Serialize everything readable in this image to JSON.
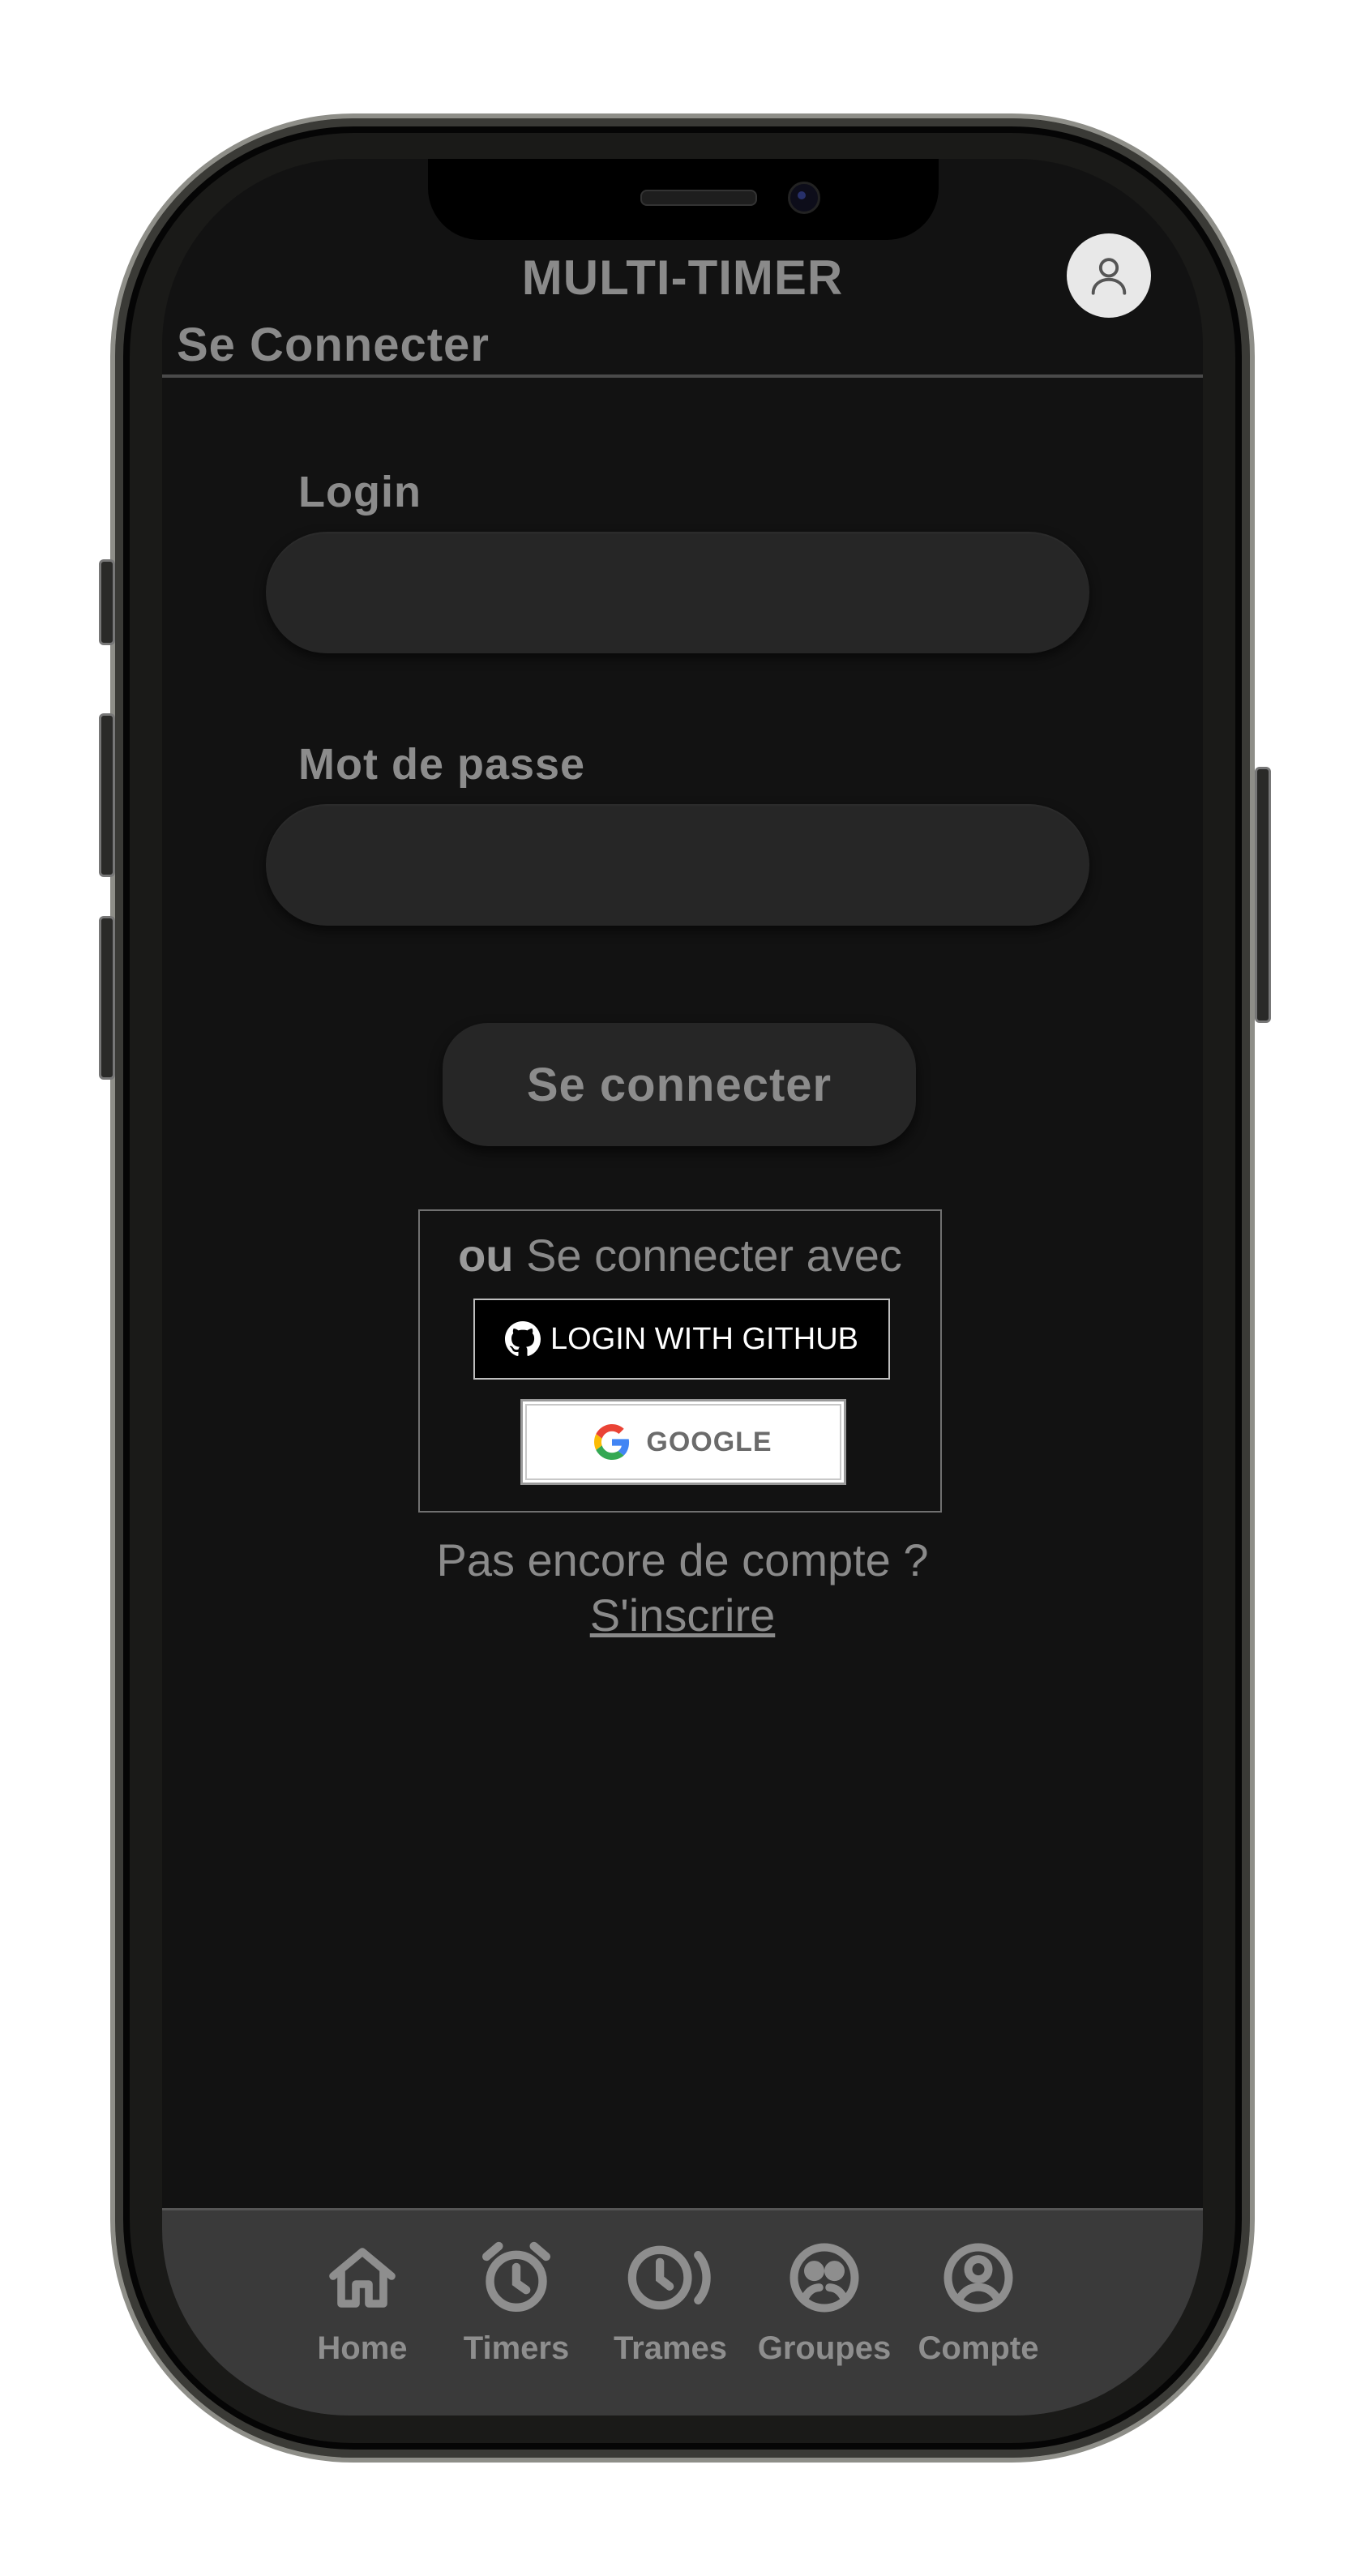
{
  "app": {
    "title": "MULTI-TIMER"
  },
  "header": {
    "page_title": "Se Connecter",
    "account_icon": "user-icon"
  },
  "form": {
    "login_label": "Login",
    "login_value": "",
    "password_label": "Mot de passe",
    "password_value": "",
    "submit_label": "Se connecter"
  },
  "oauth": {
    "intro_bold": "ou",
    "intro_text": " Se connecter avec",
    "github_label": "LOGIN WITH GITHUB",
    "google_label": "GOOGLE"
  },
  "signup": {
    "prompt": "Pas encore de compte ?",
    "link_label": "S'inscrire"
  },
  "nav": {
    "items": [
      {
        "label": "Home",
        "icon": "home-icon"
      },
      {
        "label": "Timers",
        "icon": "alarm-clock-icon"
      },
      {
        "label": "Trames",
        "icon": "history-clock-icon"
      },
      {
        "label": "Groupes",
        "icon": "group-icon"
      },
      {
        "label": "Compte",
        "icon": "account-circle-icon"
      }
    ]
  },
  "colors": {
    "screen_bg": "#121212",
    "text_muted": "#8a8a8a",
    "input_bg": "#262626",
    "nav_bg": "#3a3a3a"
  }
}
